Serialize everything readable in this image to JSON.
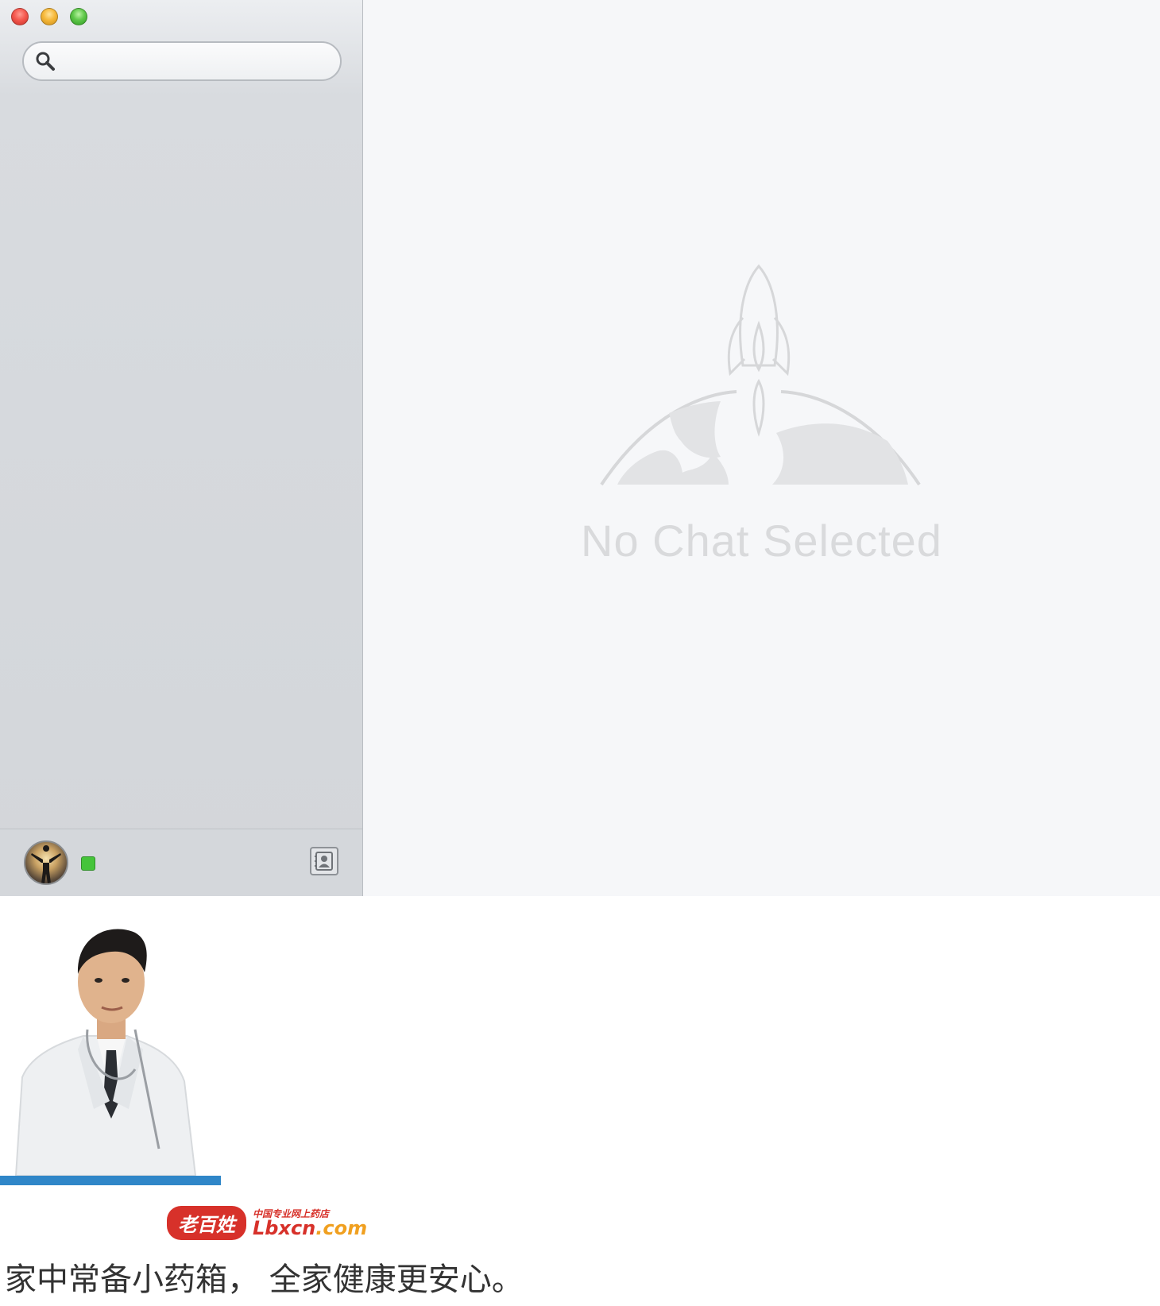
{
  "app": {
    "search": {
      "value": "",
      "placeholder": ""
    },
    "main": {
      "empty_state_text": "No Chat Selected"
    },
    "footer": {
      "status_color": "#45c43a"
    }
  },
  "ad": {
    "logo_text": "老百姓",
    "logo_tagline": "中国专业网上药店",
    "logo_domain_part1": "Lbxcn",
    "logo_domain_part2": ".com",
    "slogan": "家中常备小药箱， 全家健康更安心。",
    "bar_color": "#2f86c8"
  },
  "icons": [
    "close-icon",
    "minimize-icon",
    "zoom-icon",
    "search-icon",
    "contacts-icon",
    "rocket-globe-icon"
  ]
}
